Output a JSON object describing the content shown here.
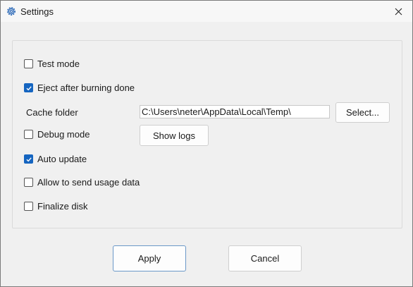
{
  "window": {
    "title": "Settings",
    "icon": "gear-icon",
    "close_glyph": "✕"
  },
  "options": {
    "test_mode": {
      "label": "Test mode",
      "checked": false
    },
    "eject_after_burning": {
      "label": "Eject after burning done",
      "checked": true
    },
    "debug_mode": {
      "label": "Debug mode",
      "checked": false
    },
    "auto_update": {
      "label": "Auto update",
      "checked": true
    },
    "send_usage_data": {
      "label": "Allow to send usage data",
      "checked": false
    },
    "finalize_disk": {
      "label": "Finalize disk",
      "checked": false
    }
  },
  "cache": {
    "label": "Cache folder",
    "path": "C:\\Users\\neter\\AppData\\Local\\Temp\\",
    "select_label": "Select..."
  },
  "show_logs_label": "Show logs",
  "footer": {
    "apply_label": "Apply",
    "cancel_label": "Cancel"
  },
  "colors": {
    "accent": "#1565c0"
  }
}
